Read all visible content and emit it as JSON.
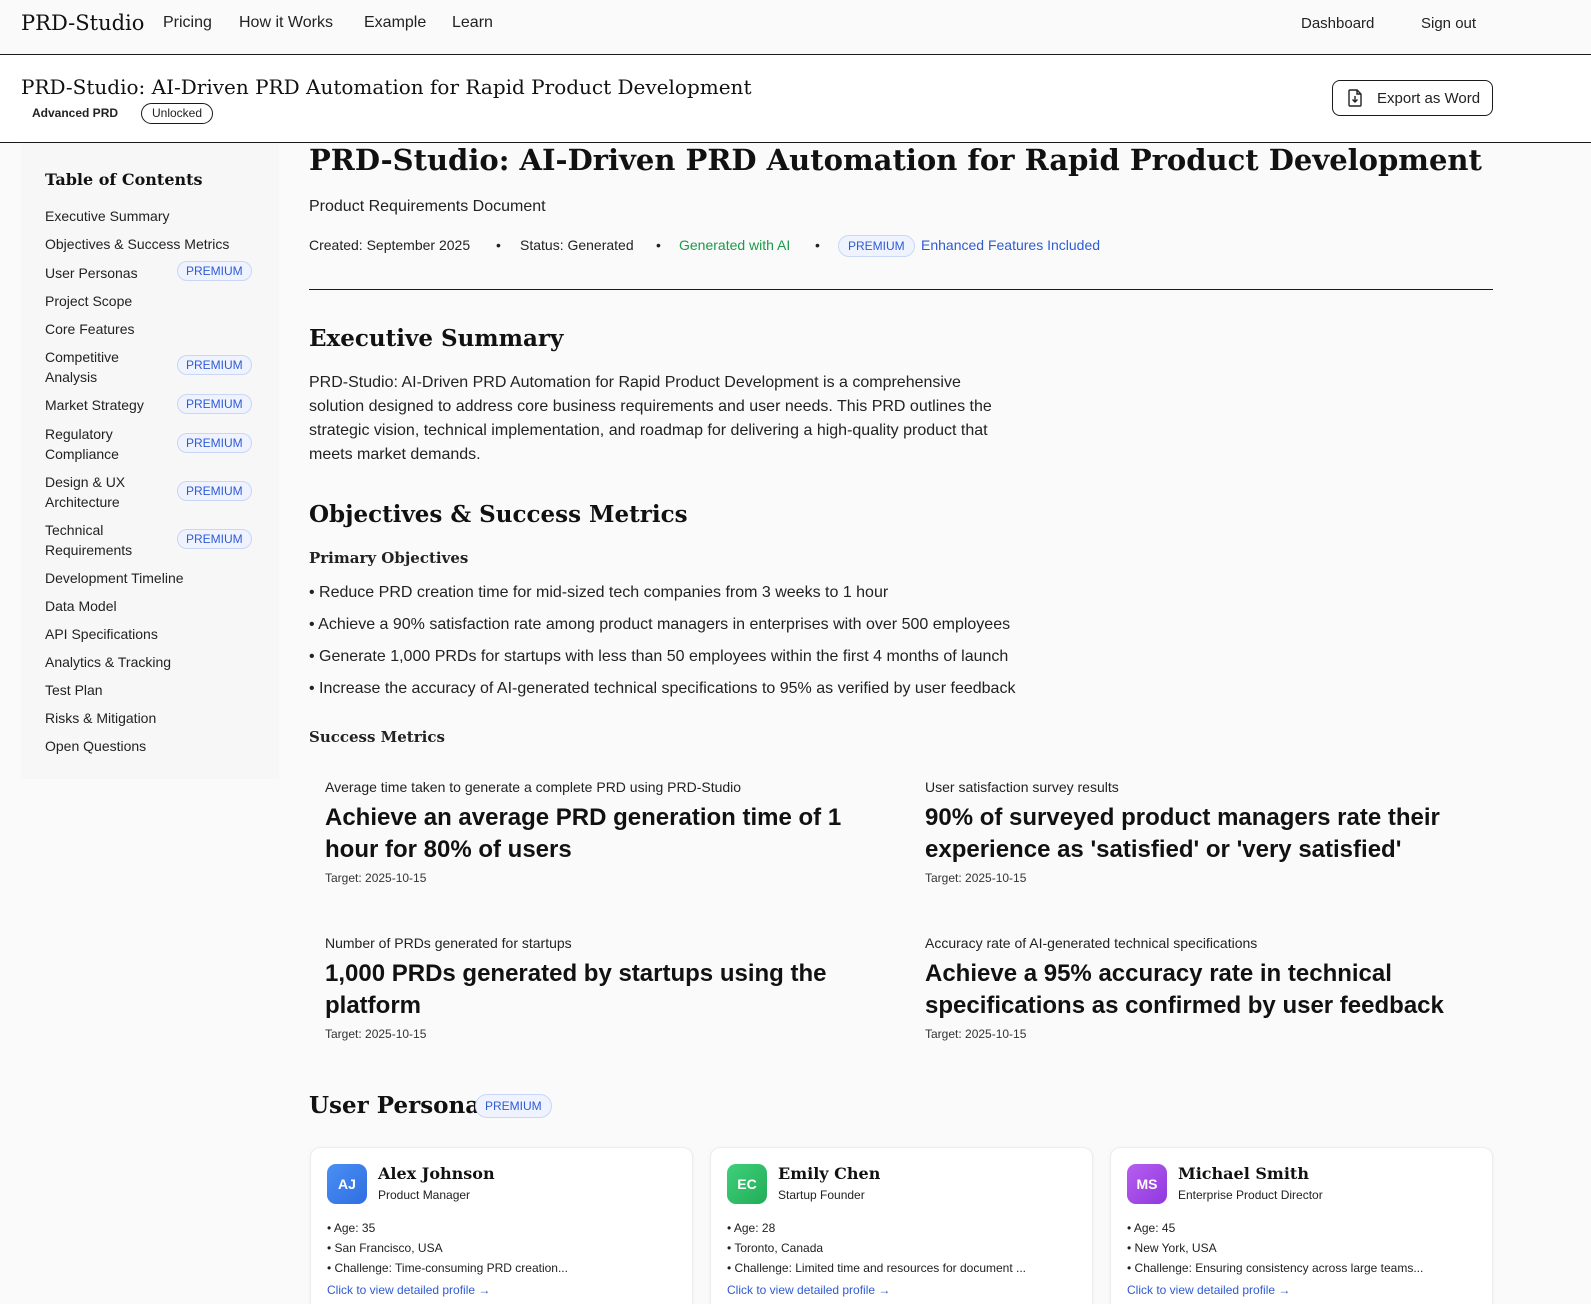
{
  "nav": {
    "brand": "PRD-Studio",
    "links": [
      "Pricing",
      "How it Works",
      "Example",
      "Learn"
    ],
    "dashboard": "Dashboard",
    "signout": "Sign out"
  },
  "subheader": {
    "title": "PRD-Studio: AI-Driven PRD Automation for Rapid Product Development",
    "badge_text": "Advanced PRD",
    "badge_pill": "Unlocked",
    "export_label": "Export as Word",
    "export_icon": "document-download-icon"
  },
  "toc": {
    "title": "Table of Contents",
    "badge": "PREMIUM",
    "items": [
      {
        "label": "Executive Summary"
      },
      {
        "label": "Objectives & Success Metrics"
      },
      {
        "label": "User Personas",
        "premium": true
      },
      {
        "label": "Project Scope"
      },
      {
        "label": "Core Features"
      },
      {
        "label": "Competitive Analysis",
        "premium": true
      },
      {
        "label": "Market Strategy",
        "premium": true
      },
      {
        "label": "Regulatory Compliance",
        "premium": true
      },
      {
        "label": "Design & UX Architecture",
        "premium": true
      },
      {
        "label": "Technical Requirements",
        "premium": true
      },
      {
        "label": "Development Timeline"
      },
      {
        "label": "Data Model"
      },
      {
        "label": "API Specifications"
      },
      {
        "label": "Analytics & Tracking"
      },
      {
        "label": "Test Plan"
      },
      {
        "label": "Risks & Mitigation"
      },
      {
        "label": "Open Questions"
      }
    ]
  },
  "doc": {
    "title": "PRD-Studio: AI-Driven PRD Automation for Rapid Product Development",
    "type": "Product Requirements Document",
    "created": "Created: September 2025",
    "status": "Status: Generated",
    "generated": "Generated with AI",
    "premium": "PREMIUM",
    "enhanced": "Enhanced Features Included",
    "dot": "•"
  },
  "executive": {
    "heading": "Executive Summary",
    "text": "PRD-Studio: AI-Driven PRD Automation for Rapid Product Development is a comprehensive solution designed to address core business requirements and user needs. This PRD outlines the strategic vision, technical implementation, and roadmap for delivering a high-quality product that meets market demands."
  },
  "objectives": {
    "heading": "Objectives & Success Metrics",
    "primary_heading": "Primary Objectives",
    "items": [
      "• Reduce PRD creation time for mid-sized tech companies from 3 weeks to 1 hour",
      "• Achieve a 90% satisfaction rate among product managers in enterprises with over 500 employees",
      "• Generate 1,000 PRDs for startups with less than 50 employees within the first 4 months of launch",
      "• Increase the accuracy of AI-generated technical specifications to 95% as verified by user feedback"
    ],
    "metrics_heading": "Success Metrics",
    "metrics": [
      {
        "label": "Average time taken to generate a complete PRD using PRD-Studio",
        "value": "Achieve an average PRD generation time of 1 hour for 80% of users",
        "target": "Target: 2025-10-15"
      },
      {
        "label": "User satisfaction survey results",
        "value": "90% of surveyed product managers rate their experience as 'satisfied' or 'very satisfied'",
        "target": "Target: 2025-10-15"
      },
      {
        "label": "Number of PRDs generated for startups",
        "value": "1,000 PRDs generated by startups using the platform",
        "target": "Target: 2025-10-15"
      },
      {
        "label": "Accuracy rate of AI-generated technical specifications",
        "value": "Achieve a 95% accuracy rate in technical specifications as confirmed by user feedback",
        "target": "Target: 2025-10-15"
      }
    ]
  },
  "personas": {
    "heading": "User Personas",
    "badge": "PREMIUM",
    "link": "Click to view detailed profile →",
    "items": [
      {
        "initials": "AJ",
        "name": "Alex Johnson",
        "role": "Product Manager",
        "age": "• Age: 35",
        "location": "• San Francisco, USA",
        "challenge": "• Challenge: Time-consuming PRD creation...",
        "color": "#3b7ef0"
      },
      {
        "initials": "EC",
        "name": "Emily Chen",
        "role": "Startup Founder",
        "age": "• Age: 28",
        "location": "• Toronto, Canada",
        "challenge": "• Challenge: Limited time and resources for document ...",
        "color": "#2fc26a"
      },
      {
        "initials": "MS",
        "name": "Michael Smith",
        "role": "Enterprise Product Director",
        "age": "• Age: 45",
        "location": "• New York, USA",
        "challenge": "• Challenge: Ensuring consistency across large teams...",
        "color": "#a24be6"
      }
    ]
  }
}
